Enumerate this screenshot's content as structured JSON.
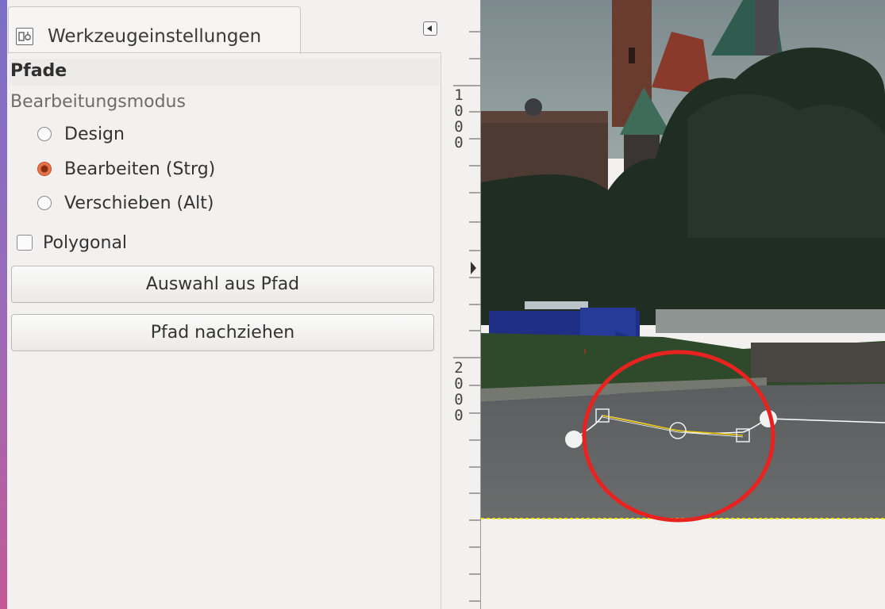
{
  "dock": {
    "tab_title": "Werkzeugeinstellungen",
    "tool_name": "Pfade",
    "mode_group_label": "Bearbeitungsmodus",
    "modes": [
      {
        "label": "Design",
        "checked": false
      },
      {
        "label": "Bearbeiten (Strg)",
        "checked": true
      },
      {
        "label": "Verschieben (Alt)",
        "checked": false
      }
    ],
    "polygonal_label": "Polygonal",
    "polygonal_checked": false,
    "buttons": {
      "selection_from_path": "Auswahl aus Pfad",
      "stroke_path": "Pfad nachziehen"
    }
  },
  "ruler": {
    "label_1000": "1000",
    "label_2000": "2000"
  },
  "colors": {
    "highlight_circle": "#e8231f",
    "path_line": "#ffffff",
    "handle_line": "#e8c200",
    "selection_border": "#f0e400"
  },
  "icons": {
    "tab_icon": "tool-options-icon",
    "collapse": "collapse-left-icon"
  }
}
